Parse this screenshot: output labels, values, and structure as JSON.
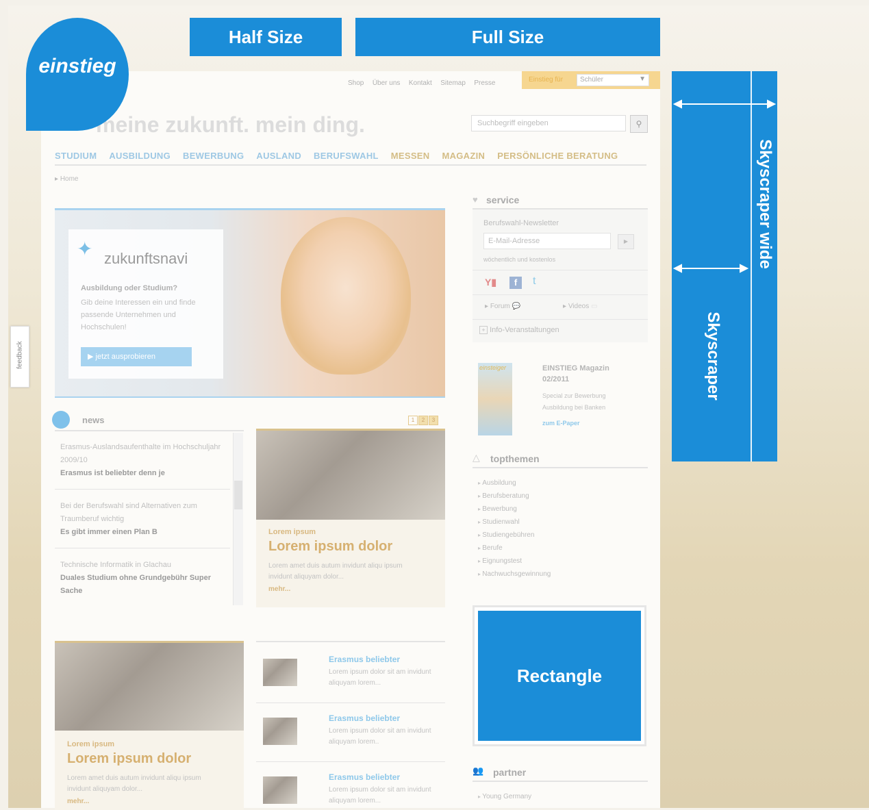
{
  "ad_slots": {
    "half_size": "Half Size",
    "full_size": "Full Size",
    "skyscraper_wide": "Skyscraper wide",
    "skyscraper": "Skyscraper",
    "rectangle": "Rectangle"
  },
  "logo": {
    "text": "einstieg"
  },
  "feedback": "feedback",
  "top_links": [
    "Shop",
    "Über uns",
    "Kontakt",
    "Sitemap",
    "Presse"
  ],
  "einstieg_fuer": {
    "label": "Einstieg für",
    "value": "Schüler"
  },
  "slogan": "meine zukunft. mein ding.",
  "search": {
    "placeholder": "Suchbegriff eingeben"
  },
  "main_nav": [
    "STUDIUM",
    "AUSBILDUNG",
    "BEWERBUNG",
    "AUSLAND",
    "BERUFSWAHL",
    "MESSEN",
    "MAGAZIN",
    "PERSÖNLICHE BERATUNG"
  ],
  "breadcrumb": "Home",
  "hero": {
    "brand": "zukunftsnavi",
    "headline": "Ausbildung oder Studium?",
    "text": "Gib deine Interessen ein und finde passende Unternehmen und Hochschulen!",
    "button": "jetzt ausprobieren"
  },
  "news": {
    "title": "news",
    "pages": [
      "1",
      "2",
      "3"
    ],
    "items": [
      {
        "line": "Erasmus-Auslandsaufenthalte im Hochschuljahr 2009/10",
        "headline": "Erasmus ist beliebter denn je"
      },
      {
        "line": "Bei der Berufswahl sind Alternativen zum Traumberuf wichtig",
        "headline": "Es gibt immer einen Plan B"
      },
      {
        "line": "Technische Informatik in Glachau",
        "headline": "Duales Studium ohne Grundgebühr Super Sache"
      }
    ]
  },
  "teaser1": {
    "kicker": "Lorem ipsum",
    "title": "Lorem ipsum dolor",
    "text": "Lorem amet duis autum invidunt aliqu ipsum invidunt aliquyam dolor...",
    "more": "mehr..."
  },
  "teaser2": {
    "kicker": "Lorem ipsum",
    "title": "Lorem ipsum dolor",
    "text": "Lorem amet duis autum invidunt aliqu ipsum invidunt aliquyam dolor...",
    "more": "mehr..."
  },
  "mini_list": [
    {
      "title": "Erasmus beliebter",
      "text": "Lorem ipsum dolor sit am invidunt aliquyam lorem..."
    },
    {
      "title": "Erasmus beliebter",
      "text": "Lorem ipsum dolor sit am invidunt aliquyam lorem.."
    },
    {
      "title": "Erasmus beliebter",
      "text": "Lorem ipsum dolor sit am invidunt aliquyam lorem..."
    }
  ],
  "service": {
    "title": "service",
    "newsletter_label": "Berufswahl-Newsletter",
    "email_placeholder": "E-Mail-Adresse",
    "note": "wöchentlich und kostenlos",
    "forum": "Forum",
    "videos": "Videos",
    "info": "Info-Veranstaltungen"
  },
  "magazine": {
    "cover_word": "einsteiger",
    "title": "EINSTIEG Magazin 02/2011",
    "text": "Special zur Bewerbung Ausbildung bei Banken",
    "link": "zum E-Paper"
  },
  "topthemen": {
    "title": "topthemen",
    "items": [
      "Ausbildung",
      "Berufsberatung",
      "Bewerbung",
      "Studienwahl",
      "Studiengebühren",
      "Berufe",
      "Eignungstest",
      "Nachwuchsgewinnung"
    ]
  },
  "partner": {
    "title": "partner",
    "items": [
      "Young Germany"
    ]
  },
  "colors": {
    "ad_blue": "#1b8dd8",
    "accent_gold": "#cda36a"
  }
}
